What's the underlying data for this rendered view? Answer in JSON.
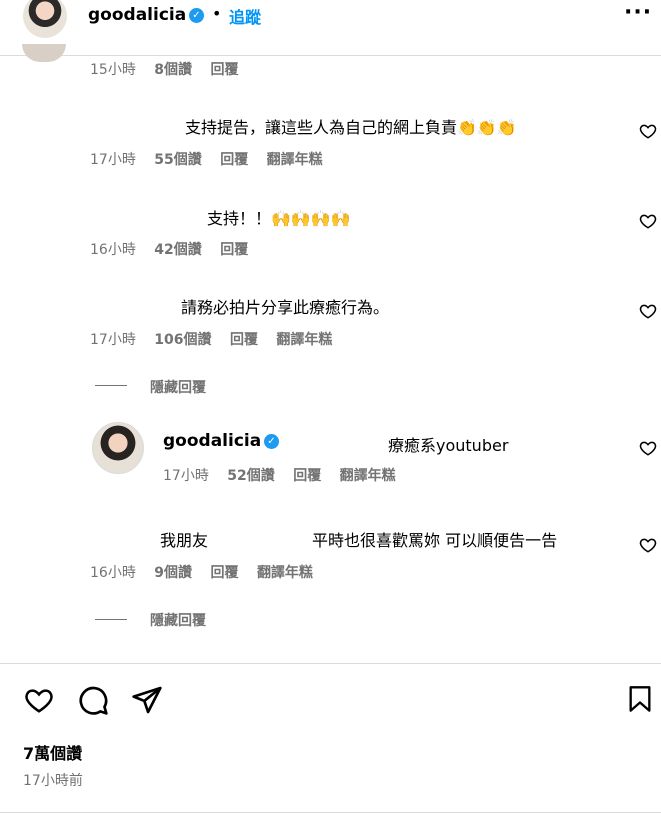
{
  "header": {
    "username": "goodalicia",
    "separator": "•",
    "follow_label": "追蹤",
    "more_icon": "more-icon"
  },
  "comments": [
    {
      "time": "15小時",
      "likes": "8個讚",
      "reply": "回覆"
    },
    {
      "text": "支持提告，讓這些人為自己的網上負責👏👏👏",
      "time": "17小時",
      "likes": "55個讚",
      "reply": "回覆",
      "translate": "翻譯年糕"
    },
    {
      "text": "支持！！🙌🙌🙌🙌",
      "time": "16小時",
      "likes": "42個讚",
      "reply": "回覆"
    },
    {
      "text": "請務必拍片分享此療癒行為。",
      "time": "17小時",
      "likes": "106個讚",
      "reply": "回覆",
      "translate": "翻譯年糕"
    },
    {
      "text_a": "我朋友",
      "text_b": "平時也很喜歡罵妳 可以順便告一告",
      "time": "16小時",
      "likes": "9個讚",
      "reply": "回覆",
      "translate": "翻譯年糕"
    }
  ],
  "hidden_replies_label": "隱藏回覆",
  "reply": {
    "username": "goodalicia",
    "text": "療癒系youtuber",
    "time": "17小時",
    "likes": "52個讚",
    "reply": "回覆",
    "translate": "翻譯年糕"
  },
  "footer": {
    "likes_count": "7萬個讚",
    "posted": "17小時前"
  },
  "colors": {
    "accent": "#0095f6",
    "verified": "#1d9bf0",
    "muted": "#737373"
  }
}
